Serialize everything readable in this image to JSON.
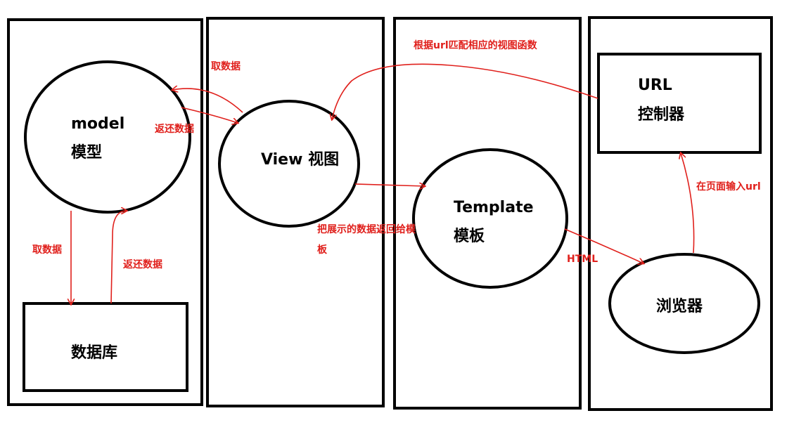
{
  "nodes": {
    "model_line1": "model",
    "model_line2": "模型",
    "database": "数据库",
    "view": "View 视图",
    "template_line1": "Template",
    "template_line2": "模板",
    "url_line1": "URL",
    "url_line2": "控制器",
    "browser": "浏览器"
  },
  "edges": {
    "view_get_data": "取数据",
    "view_return_data": "返还数据",
    "model_get_data": "取数据",
    "db_return_data": "返还数据",
    "view_to_template_line1": "把展示的数据返回给模",
    "view_to_template_line2": "板",
    "url_to_view": "根据url匹配相应的视图函数",
    "template_to_browser": "HTML",
    "browser_to_url": "在页面输入url"
  },
  "colors": {
    "frame": "#000000",
    "arrow": "#e0201c"
  }
}
